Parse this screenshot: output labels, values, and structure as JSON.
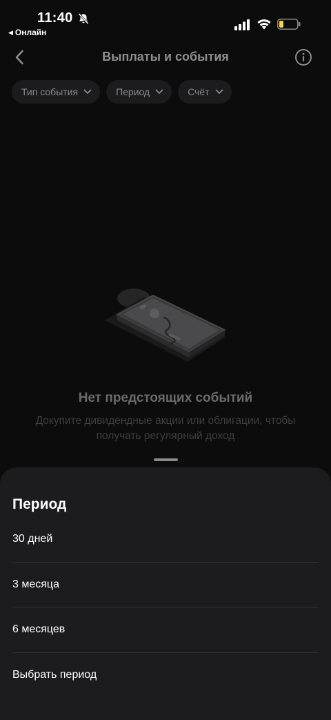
{
  "status_bar": {
    "time": "11:40",
    "back_app": "Онлайн",
    "icons": [
      "bell-slash-icon",
      "signal-icon",
      "wifi-icon",
      "battery-low-icon"
    ],
    "battery_color": "#f5d24a"
  },
  "nav": {
    "title": "Выплаты и события",
    "back_icon": "chevron-left-icon",
    "info_icon": "info-circle-icon"
  },
  "filters": [
    {
      "label": "Тип события"
    },
    {
      "label": "Период"
    },
    {
      "label": "Счёт"
    }
  ],
  "empty_state": {
    "title": "Нет предстоящих событий",
    "description": "Докупите дивидендные акции или облигации, чтобы получать регулярный доход"
  },
  "sheet": {
    "title": "Период",
    "options": [
      {
        "label": "30 дней"
      },
      {
        "label": "3 месяца"
      },
      {
        "label": "6 месяцев"
      },
      {
        "label": "Выбрать период"
      }
    ]
  },
  "colors": {
    "background": "#0c0c0c",
    "sheet": "#1c1c1e",
    "chip": "#1c1c1e",
    "muted_text": "#8e8e8e"
  }
}
